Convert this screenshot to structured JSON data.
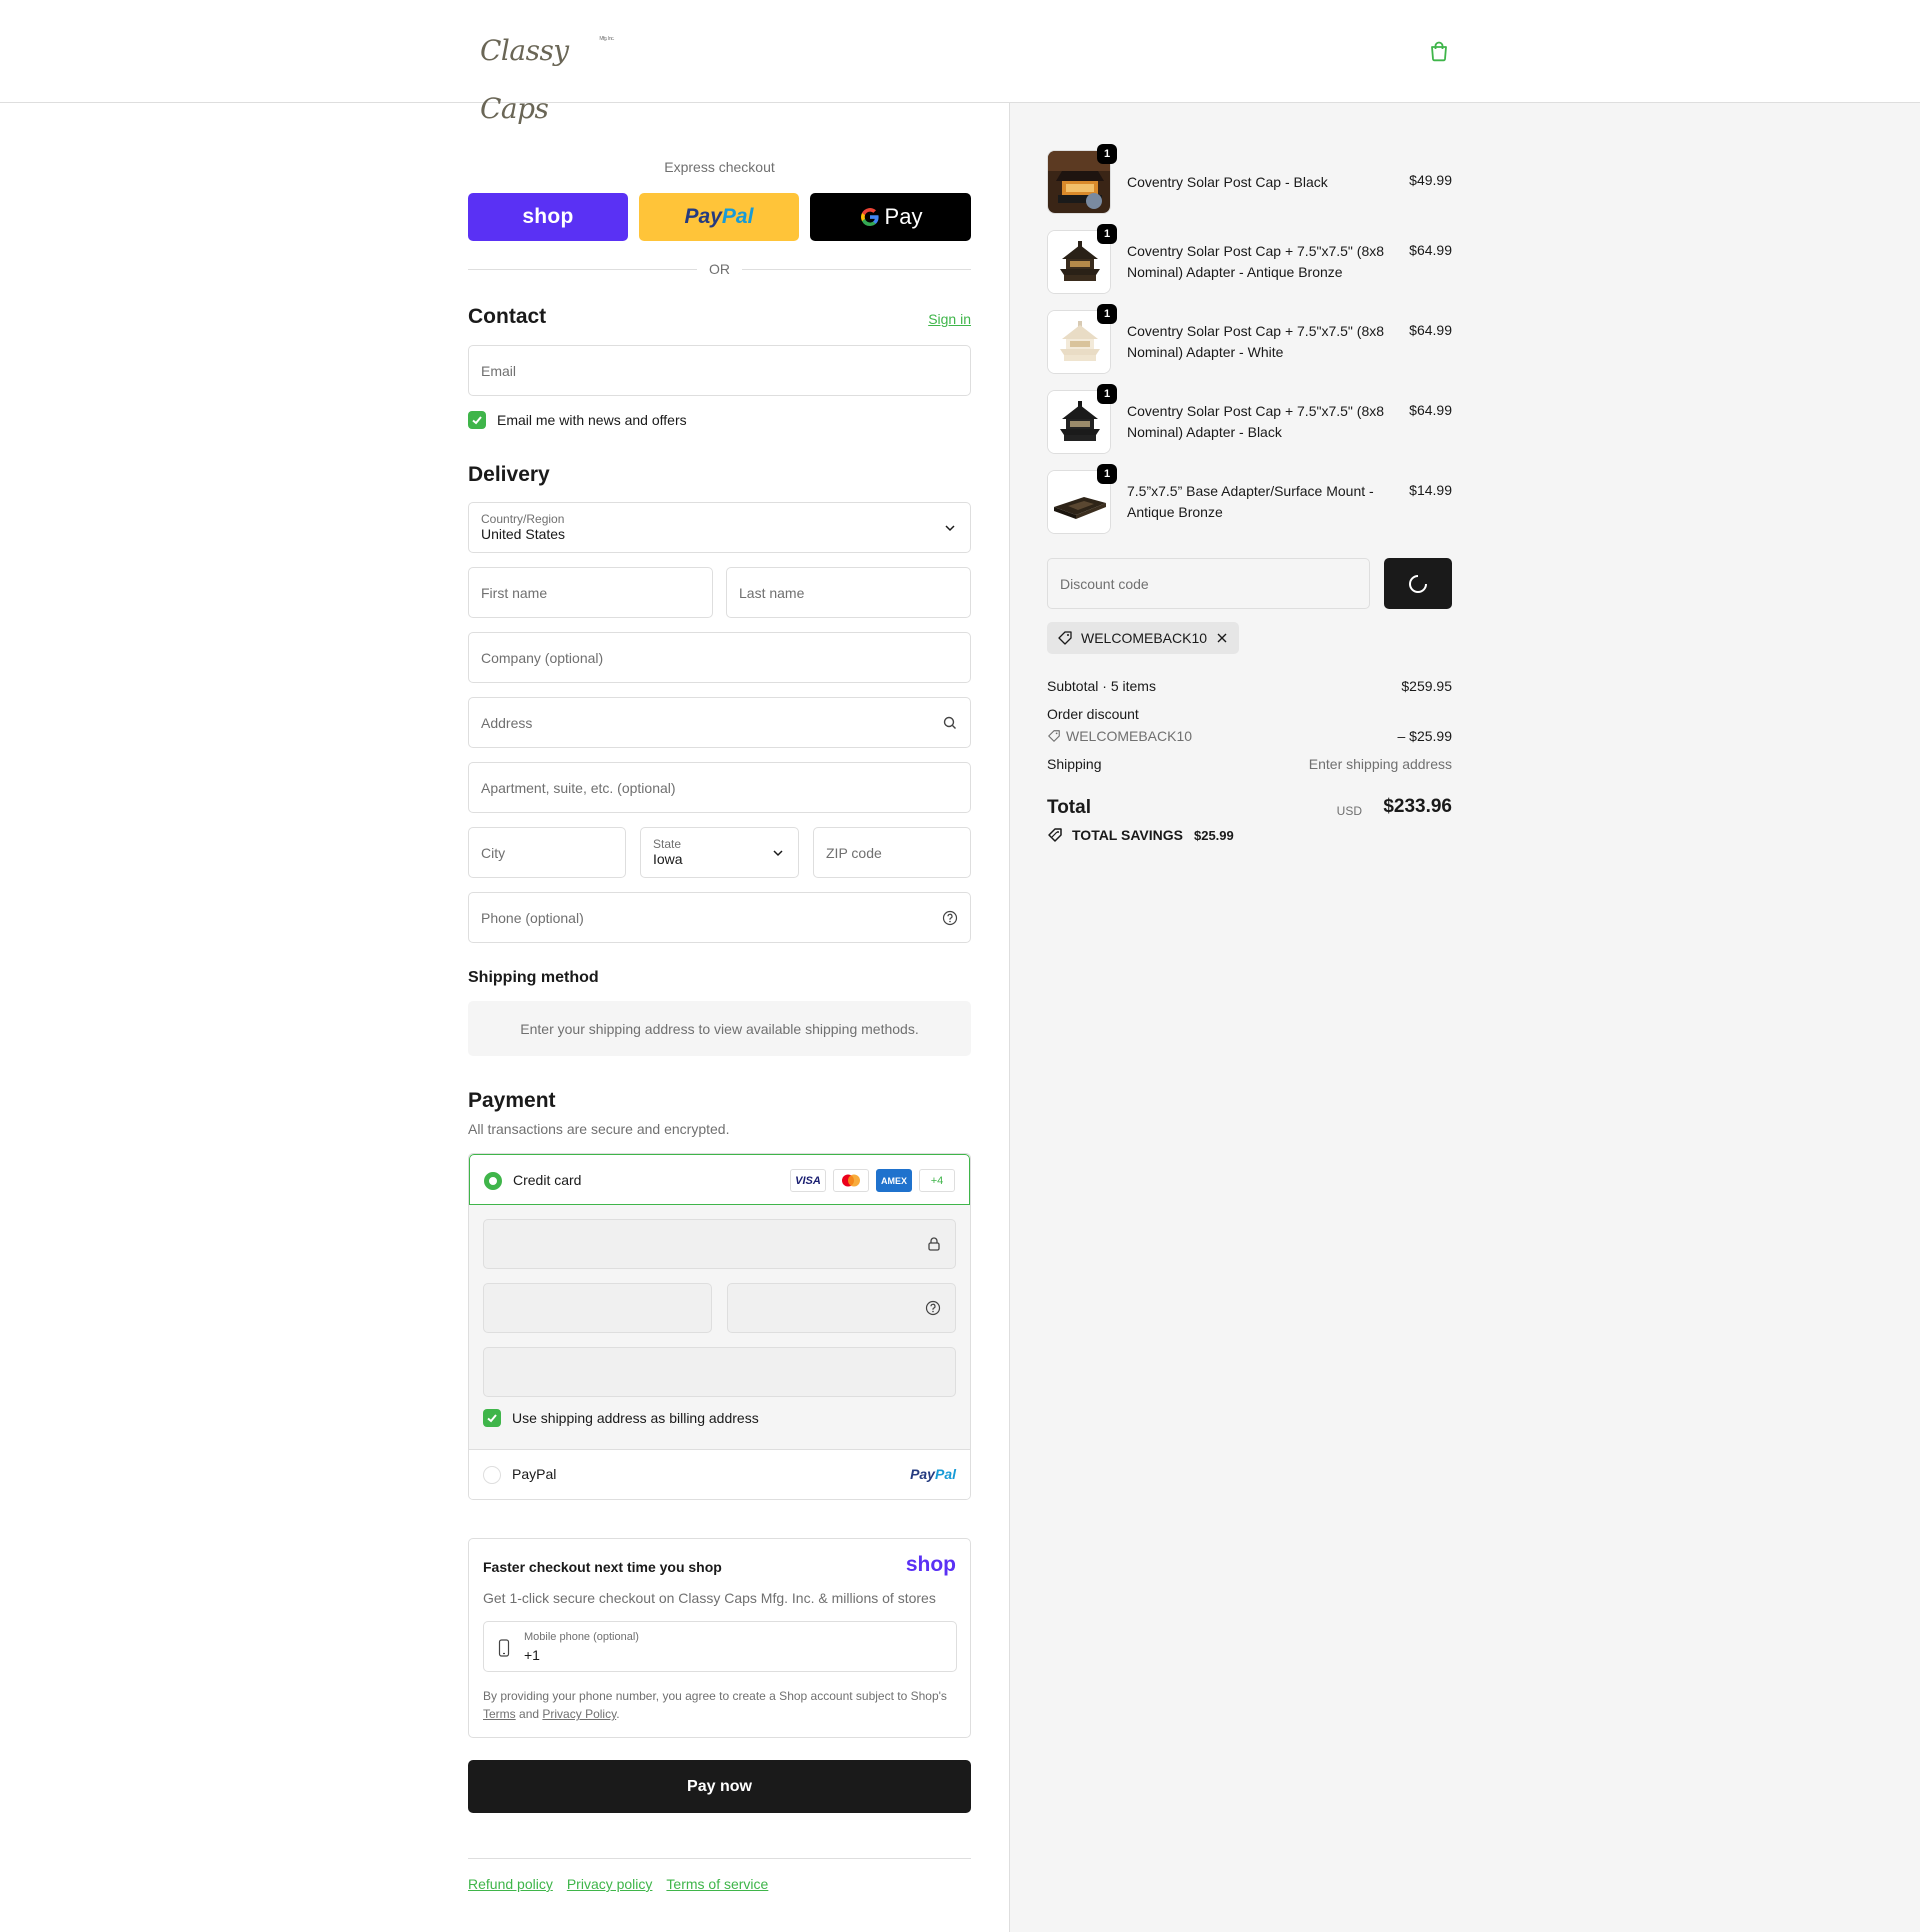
{
  "header": {
    "logo_text": "Classy Caps",
    "logo_sub": "Mfg. Inc.",
    "cart_icon": "shopping-bag-icon"
  },
  "express": {
    "label": "Express checkout",
    "shop_label": "shop",
    "paypal_part1": "Pay",
    "paypal_part2": "Pal",
    "gpay_label": "Pay",
    "or_label": "OR"
  },
  "contact": {
    "title": "Contact",
    "sign_in": "Sign in",
    "email_placeholder": "Email",
    "news_label": "Email me with news and offers"
  },
  "delivery": {
    "title": "Delivery",
    "country_label": "Country/Region",
    "country_value": "United States",
    "first_name": "First name",
    "last_name": "Last name",
    "company": "Company (optional)",
    "address": "Address",
    "apartment": "Apartment, suite, etc. (optional)",
    "city": "City",
    "state_label": "State",
    "state_value": "Iowa",
    "zip": "ZIP code",
    "phone": "Phone (optional)"
  },
  "shipping_method": {
    "title": "Shipping method",
    "message": "Enter your shipping address to view available shipping methods."
  },
  "payment": {
    "title": "Payment",
    "subtitle": "All transactions are secure and encrypted.",
    "credit_card_label": "Credit card",
    "cards": [
      "VISA",
      "MC",
      "AMEX"
    ],
    "more_cards": "+4",
    "billing_label": "Use shipping address as billing address",
    "paypal_label": "PayPal",
    "paypal_logo_1": "Pay",
    "paypal_logo_2": "Pal"
  },
  "shop_pay": {
    "title": "Faster checkout next time you shop",
    "logo": "shop",
    "description": "Get 1-click secure checkout on Classy Caps Mfg. Inc. & millions of stores",
    "mobile_label": "Mobile phone (optional)",
    "mobile_value": "+1",
    "legal_text": "By providing your phone number, you agree to create a Shop account subject to Shop's",
    "terms": "Terms",
    "and": "and",
    "privacy": "Privacy Policy",
    "period": "."
  },
  "pay_now": "Pay now",
  "footer": {
    "refund": "Refund policy",
    "privacy": "Privacy policy",
    "terms": "Terms of service"
  },
  "order": {
    "items": [
      {
        "name": "Coventry Solar Post Cap - Black",
        "price": "$49.99",
        "qty": "1"
      },
      {
        "name": "Coventry Solar Post Cap + 7.5\"x7.5\" (8x8 Nominal) Adapter - Antique Bronze",
        "price": "$64.99",
        "qty": "1"
      },
      {
        "name": "Coventry Solar Post Cap + 7.5\"x7.5\" (8x8 Nominal) Adapter - White",
        "price": "$64.99",
        "qty": "1"
      },
      {
        "name": "Coventry Solar Post Cap + 7.5\"x7.5\" (8x8 Nominal) Adapter - Black",
        "price": "$64.99",
        "qty": "1"
      },
      {
        "name": "7.5”x7.5” Base Adapter/Surface Mount - Antique Bronze",
        "price": "$14.99",
        "qty": "1"
      }
    ],
    "discount_placeholder": "Discount code",
    "applied_code": "WELCOMEBACK10",
    "subtotal_label": "Subtotal · 5 items",
    "subtotal_value": "$259.95",
    "order_discount_label": "Order discount",
    "discount_code": "WELCOMEBACK10",
    "discount_value": "– $25.99",
    "shipping_label": "Shipping",
    "shipping_value": "Enter shipping address",
    "total_label": "Total",
    "currency": "USD",
    "total_value": "$233.96",
    "savings_label": "TOTAL SAVINGS",
    "savings_value": "$25.99"
  },
  "colors": {
    "accent": "#3fb54a",
    "shop_purple": "#5a31f4",
    "paypal_yellow": "#ffc439",
    "dark": "#1a1a1a"
  }
}
